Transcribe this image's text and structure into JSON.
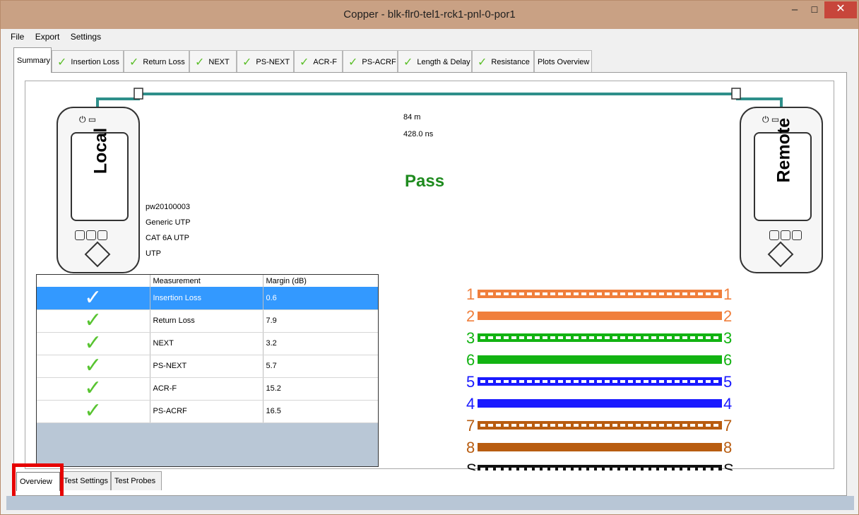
{
  "window": {
    "title": "Copper - blk-flr0-tel1-rck1-pnl-0-por1",
    "min_glyph": "–",
    "max_glyph": "☐",
    "close_glyph": "✕"
  },
  "menu": [
    "File",
    "Export",
    "Settings"
  ],
  "tabs": [
    {
      "label": "Summary",
      "checked": false
    },
    {
      "label": "Insertion Loss",
      "checked": true
    },
    {
      "label": "Return Loss",
      "checked": true
    },
    {
      "label": "NEXT",
      "checked": true
    },
    {
      "label": "PS-NEXT",
      "checked": true
    },
    {
      "label": "ACR-F",
      "checked": true
    },
    {
      "label": "PS-ACRF",
      "checked": true
    },
    {
      "label": "Length & Delay",
      "checked": true
    },
    {
      "label": "Resistance",
      "checked": true
    },
    {
      "label": "Plots Overview",
      "checked": false
    }
  ],
  "summary": {
    "length": "84 m",
    "delay": "428.0 ns",
    "result": "Pass",
    "local_label": "Local",
    "remote_label": "Remote",
    "info": [
      "pw20100003",
      "Generic UTP",
      "CAT 6A UTP",
      "UTP"
    ]
  },
  "results_table": {
    "headers": [
      "",
      "Measurement",
      "Margin (dB)"
    ],
    "rows": [
      {
        "measurement": "Insertion Loss",
        "margin": "0.6"
      },
      {
        "measurement": "Return Loss",
        "margin": "7.9"
      },
      {
        "measurement": "NEXT",
        "margin": "3.2"
      },
      {
        "measurement": "PS-NEXT",
        "margin": "5.7"
      },
      {
        "measurement": "ACR-F",
        "margin": "15.2"
      },
      {
        "measurement": "PS-ACRF",
        "margin": "16.5"
      }
    ]
  },
  "wiremap": [
    {
      "label": "1",
      "color": "#f07f3c",
      "striped": true
    },
    {
      "label": "2",
      "color": "#f07f3c",
      "striped": false
    },
    {
      "label": "3",
      "color": "#12b312",
      "striped": true
    },
    {
      "label": "6",
      "color": "#12b312",
      "striped": false
    },
    {
      "label": "5",
      "color": "#1a1aff",
      "striped": true
    },
    {
      "label": "4",
      "color": "#1a1aff",
      "striped": false
    },
    {
      "label": "7",
      "color": "#b85c10",
      "striped": true
    },
    {
      "label": "8",
      "color": "#b85c10",
      "striped": false
    },
    {
      "label": "S",
      "color": "#111111",
      "striped": true
    }
  ],
  "bottom_tabs": [
    "Overview",
    "Test Settings",
    "Test Probes"
  ],
  "colors": {
    "titlebar": "#c9a184",
    "pass_green": "#1f8b1f",
    "selected_row": "#3399ff",
    "cable": "#2e8f8a",
    "highlight": "#e60000"
  }
}
